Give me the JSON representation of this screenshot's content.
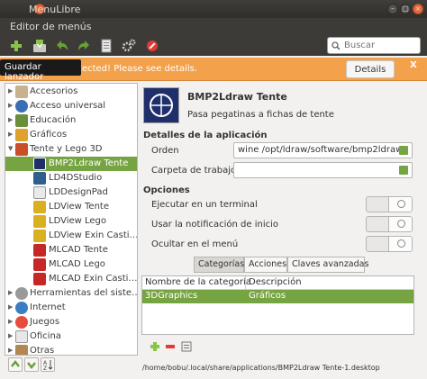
{
  "window": {
    "title": "MenuLibre",
    "menu": "Editor de menús"
  },
  "toolbar": {
    "tooltip": "Guardar lanzador",
    "search_placeholder": "Buscar",
    "icons": [
      "add-icon",
      "save-icon",
      "undo-icon",
      "redo-icon",
      "revert-icon",
      "execute-icon",
      "delete-icon"
    ]
  },
  "infobar": {
    "message": "es detected! Please see details.",
    "details_label": "Details",
    "close_label": "X"
  },
  "sidebar": {
    "items": [
      {
        "label": "Accesorios",
        "expanded": false
      },
      {
        "label": "Acceso universal",
        "expanded": false
      },
      {
        "label": "Educación",
        "expanded": false
      },
      {
        "label": "Gráficos",
        "expanded": false
      },
      {
        "label": "Tente y Lego 3D",
        "expanded": true
      },
      {
        "label": "BMP2Ldraw Tente",
        "selected": true
      },
      {
        "label": "LD4DStudio"
      },
      {
        "label": "LDDesignPad"
      },
      {
        "label": "LDView Tente"
      },
      {
        "label": "LDView Lego"
      },
      {
        "label": "LDView Exin Casti…"
      },
      {
        "label": "MLCAD Tente"
      },
      {
        "label": "MLCAD Lego"
      },
      {
        "label": "MLCAD Exin Casti…"
      },
      {
        "label": "Herramientas del siste…",
        "expanded": false
      },
      {
        "label": "Internet",
        "expanded": false
      },
      {
        "label": "Juegos",
        "expanded": false
      },
      {
        "label": "Oficina",
        "expanded": false
      },
      {
        "label": "Otras",
        "expanded": false
      }
    ]
  },
  "launcher": {
    "name": "BMP2Ldraw Tente",
    "comment": "Pasa pegatinas a fichas de tente"
  },
  "details": {
    "title": "Detalles de la aplicación",
    "order_label": "Orden",
    "order_value": "wine /opt/ldraw/software/bmp2ldraw/",
    "workdir_label": "Carpeta de trabajo",
    "workdir_value": ""
  },
  "options": {
    "title": "Opciones",
    "terminal_label": "Ejecutar en un terminal",
    "notify_label": "Usar la notificación de inicio",
    "hide_label": "Ocultar en el menú"
  },
  "tabs": {
    "categories": "Categorías",
    "actions": "Acciones",
    "advanced": "Claves avanzadas"
  },
  "categories": {
    "col_name": "Nombre de la categoría",
    "col_desc": "Descripción",
    "rows": [
      {
        "name": "3DGraphics",
        "desc": "Gráficos"
      }
    ]
  },
  "status": {
    "path": "/home/bobu/.local/share/applications/BMP2Ldraw Tente-1.desktop"
  }
}
